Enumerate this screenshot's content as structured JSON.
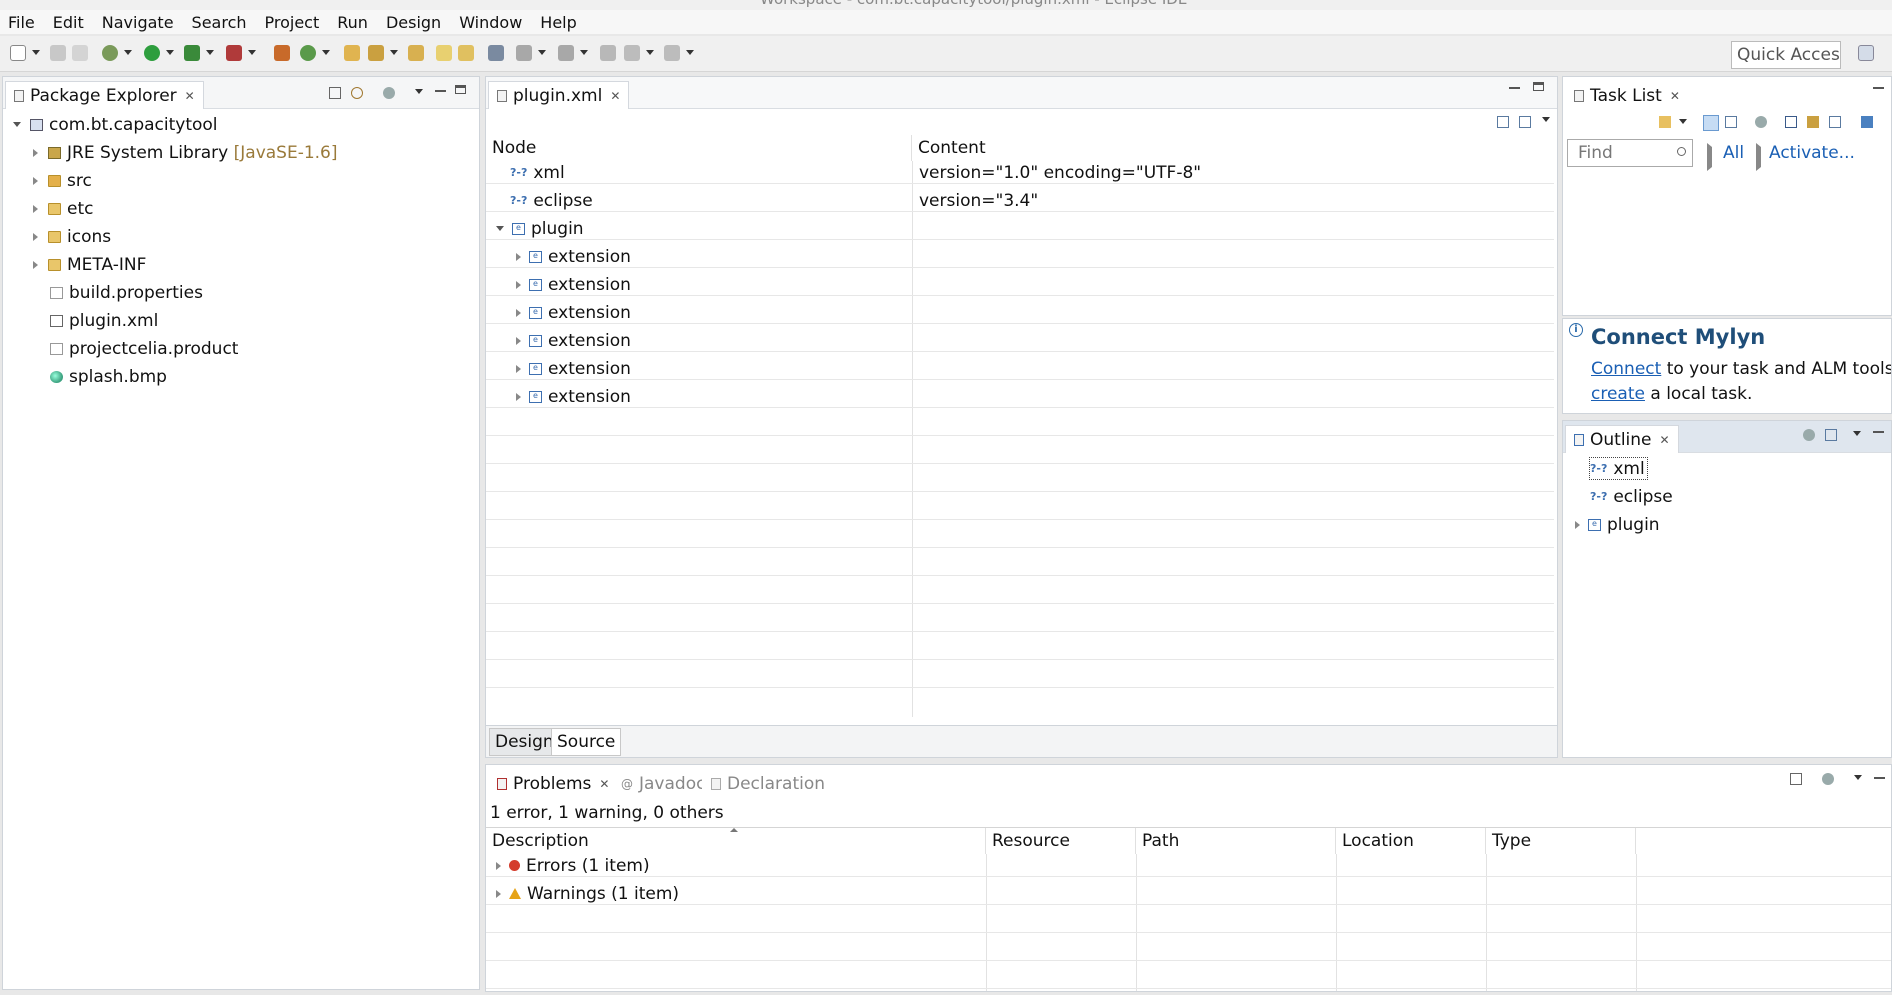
{
  "window": {
    "title": "Workspace - com.bt.capacitytool/plugin.xml - Eclipse IDE"
  },
  "menu": [
    "File",
    "Edit",
    "Navigate",
    "Search",
    "Project",
    "Run",
    "Design",
    "Window",
    "Help"
  ],
  "toolbar": {
    "quick_access_placeholder": "Quick Access"
  },
  "package_explorer": {
    "title": "Package Explorer",
    "project": "com.bt.capacitytool",
    "items": [
      {
        "label": "JRE System Library",
        "suffix": "[JavaSE-1.6]",
        "icon": "library-icon",
        "expandable": true
      },
      {
        "label": "src",
        "icon": "package-folder-icon",
        "expandable": true
      },
      {
        "label": "etc",
        "icon": "folder-icon",
        "expandable": true
      },
      {
        "label": "icons",
        "icon": "folder-icon",
        "expandable": true
      },
      {
        "label": "META-INF",
        "icon": "folder-icon",
        "expandable": true
      },
      {
        "label": "build.properties",
        "icon": "file-icon",
        "expandable": false
      },
      {
        "label": "plugin.xml",
        "icon": "xml-file-icon",
        "expandable": false
      },
      {
        "label": "projectcelia.product",
        "icon": "file-icon",
        "expandable": false
      },
      {
        "label": "splash.bmp",
        "icon": "image-icon",
        "expandable": false
      }
    ]
  },
  "editor": {
    "tab_label": "plugin.xml",
    "columns": {
      "node": "Node",
      "content": "Content"
    },
    "rows": [
      {
        "node": "xml",
        "content": "version=\"1.0\" encoding=\"UTF-8\"",
        "kind": "pi",
        "level": 0,
        "twisty": "none"
      },
      {
        "node": "eclipse",
        "content": "version=\"3.4\"",
        "kind": "pi",
        "level": 0,
        "twisty": "none"
      },
      {
        "node": "plugin",
        "content": "",
        "kind": "element",
        "level": 0,
        "twisty": "open"
      },
      {
        "node": "extension",
        "content": "",
        "kind": "element",
        "level": 1,
        "twisty": "closed"
      },
      {
        "node": "extension",
        "content": "",
        "kind": "element",
        "level": 1,
        "twisty": "closed"
      },
      {
        "node": "extension",
        "content": "",
        "kind": "element",
        "level": 1,
        "twisty": "closed"
      },
      {
        "node": "extension",
        "content": "",
        "kind": "element",
        "level": 1,
        "twisty": "closed"
      },
      {
        "node": "extension",
        "content": "",
        "kind": "element",
        "level": 1,
        "twisty": "closed"
      },
      {
        "node": "extension",
        "content": "",
        "kind": "element",
        "level": 1,
        "twisty": "closed"
      }
    ],
    "bottom_tabs": {
      "design": "Design",
      "source": "Source"
    }
  },
  "task_list": {
    "title": "Task List",
    "find_placeholder": "Find",
    "all_label": "All",
    "activate_label": "Activate..."
  },
  "connect_mylyn": {
    "title": "Connect Mylyn",
    "connect_link": "Connect",
    "connect_text": " to your task and ALM tools o",
    "create_link": "create",
    "create_text": " a local task."
  },
  "outline": {
    "title": "Outline",
    "items": [
      {
        "label": "xml",
        "kind": "pi",
        "expandable": false,
        "selected": true
      },
      {
        "label": "eclipse",
        "kind": "pi",
        "expandable": false,
        "selected": false
      },
      {
        "label": "plugin",
        "kind": "element",
        "expandable": true,
        "selected": false
      }
    ]
  },
  "bottom_panel": {
    "tabs": {
      "problems": "Problems",
      "javadoc": "Javadoc",
      "declaration": "Declaration"
    },
    "summary": "1 error, 1 warning, 0 others",
    "columns": {
      "description": "Description",
      "resource": "Resource",
      "path": "Path",
      "location": "Location",
      "type": "Type"
    },
    "groups": [
      {
        "label": "Errors (1 item)",
        "severity": "error"
      },
      {
        "label": "Warnings (1 item)",
        "severity": "warning"
      }
    ]
  },
  "colors": {
    "link": "#1a5fb4",
    "library_suffix": "#9a7a3a",
    "mylyn_title": "#1f4e79"
  }
}
